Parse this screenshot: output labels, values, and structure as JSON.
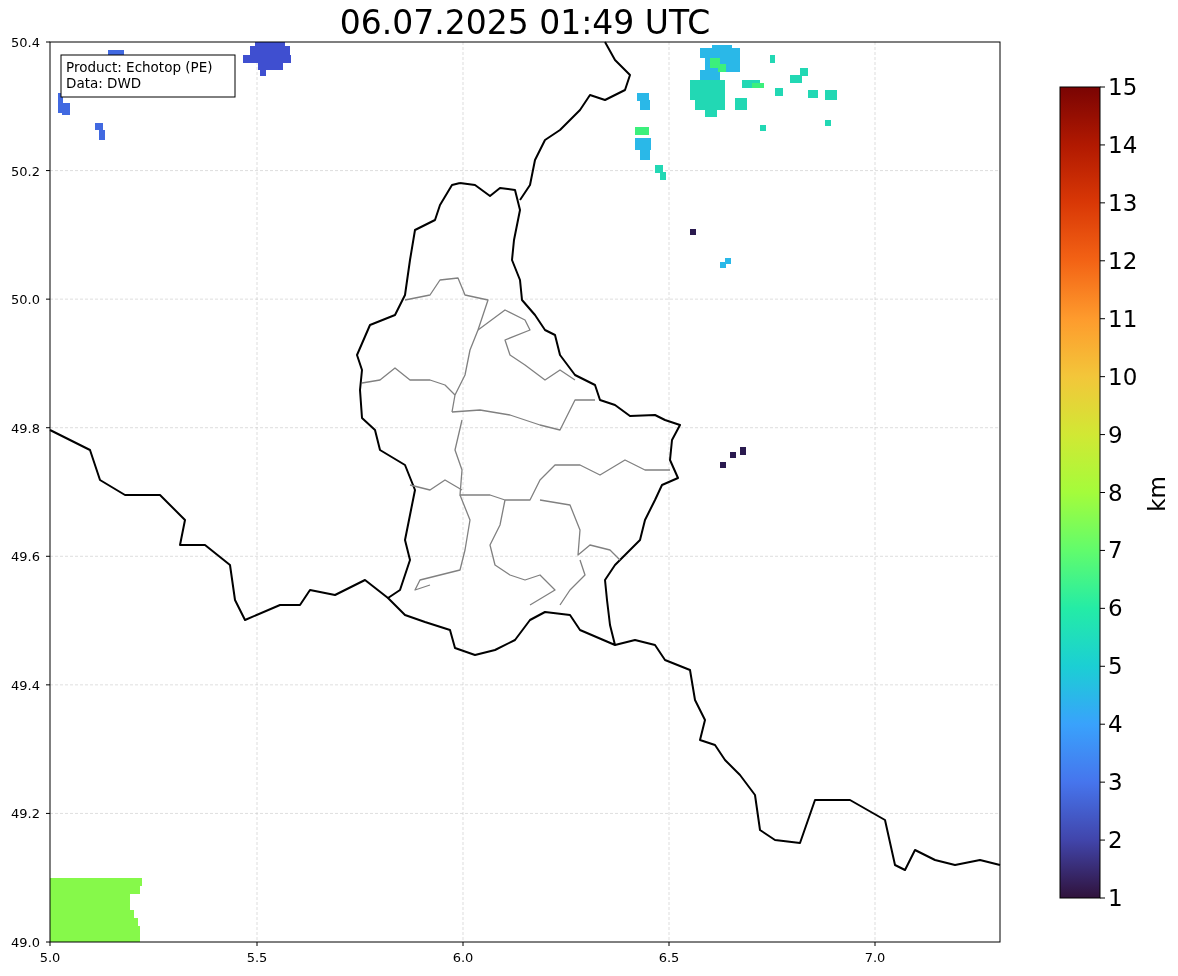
{
  "title": "06.07.2025 01:49 UTC",
  "info_box": [
    "Product: Echotop (PE)",
    "Data: DWD"
  ],
  "map": {
    "xticks": [
      "5.0",
      "5.5",
      "6.0",
      "6.5",
      "7.0"
    ],
    "yticks": [
      "50.4",
      "50.2",
      "50.0",
      "49.8",
      "49.6",
      "49.4",
      "49.2",
      "49.0"
    ]
  },
  "colorbar": {
    "label": "km",
    "ticks": [
      "15",
      "14",
      "13",
      "12",
      "11",
      "10",
      "9",
      "8",
      "7",
      "6",
      "5",
      "4",
      "3",
      "2",
      "1"
    ]
  }
}
